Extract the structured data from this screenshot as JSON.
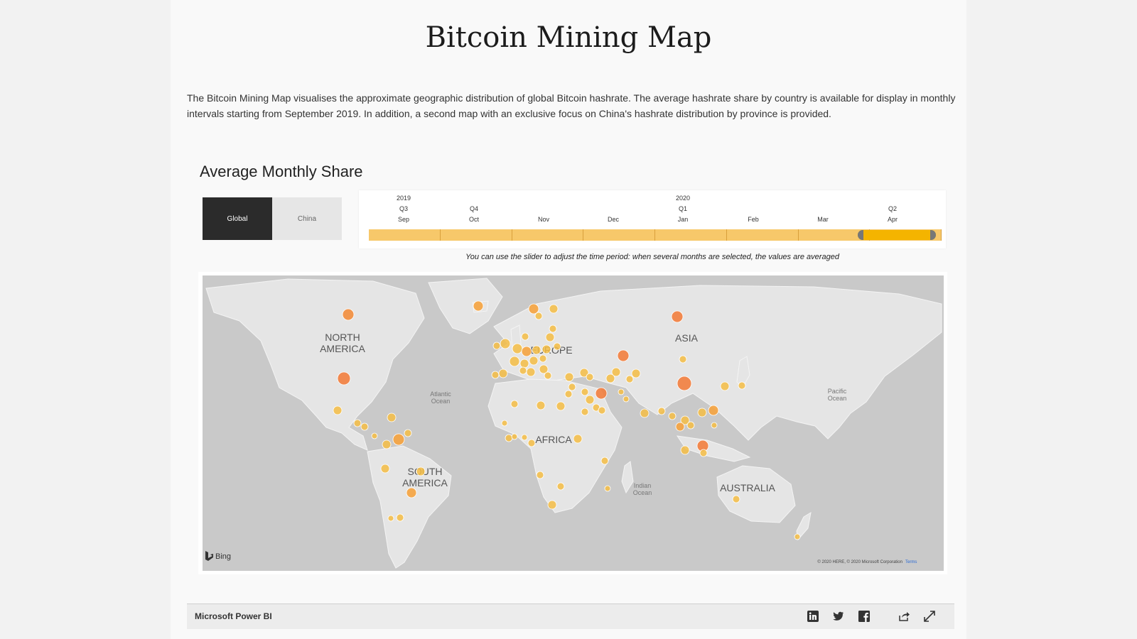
{
  "page": {
    "title": "Bitcoin Mining Map",
    "intro": "The Bitcoin Mining Map visualises the approximate geographic distribution of global Bitcoin hashrate. The average hashrate share by country is available for display in monthly intervals starting from September 2019. In addition, a second map with an exclusive focus on China's hashrate distribution by province is provided."
  },
  "section": {
    "title": "Average Monthly Share"
  },
  "toggles": {
    "global": "Global",
    "china": "China",
    "selected": "Global"
  },
  "timeline": {
    "year_2019": "2019",
    "year_2020": "2020",
    "ticks": [
      {
        "quarter": "Q3",
        "month": "Sep"
      },
      {
        "quarter": "Q4",
        "month": "Oct"
      },
      {
        "quarter": "",
        "month": "Nov"
      },
      {
        "quarter": "",
        "month": "Dec"
      },
      {
        "quarter": "Q1",
        "month": "Jan"
      },
      {
        "quarter": "",
        "month": "Feb"
      },
      {
        "quarter": "",
        "month": "Mar"
      },
      {
        "quarter": "Q2",
        "month": "Apr"
      }
    ],
    "selected_range": [
      "Apr",
      "Apr"
    ],
    "hint": "You can use the slider to adjust the time period: when several months are selected, the values are averaged"
  },
  "map": {
    "labels": {
      "north_america_1": "NORTH",
      "north_america_2": "AMERICA",
      "south_america_1": "SOUTH",
      "south_america_2": "AMERICA",
      "europe": "EUROPE",
      "asia": "ASIA",
      "africa": "AFRICA",
      "australia": "AUSTRALIA",
      "atlantic_1": "Atlantic",
      "atlantic_2": "Ocean",
      "pacific_1": "Pacific",
      "pacific_2": "Ocean",
      "indian_1": "Indian",
      "indian_2": "Ocean"
    },
    "bing": "Bing",
    "attribution": "© 2020 HERE, © 2020 Microsoft Corporation",
    "terms": "Terms",
    "colors": {
      "land": "#e5e5e5",
      "water": "#c9c9c9",
      "dot_small": "#f5bd45",
      "dot_large": "#f27e3e"
    }
  },
  "footer": {
    "brand": "Microsoft Power BI",
    "icons": [
      "linkedin-icon",
      "twitter-icon",
      "facebook-icon",
      "share-icon",
      "expand-icon"
    ]
  }
}
